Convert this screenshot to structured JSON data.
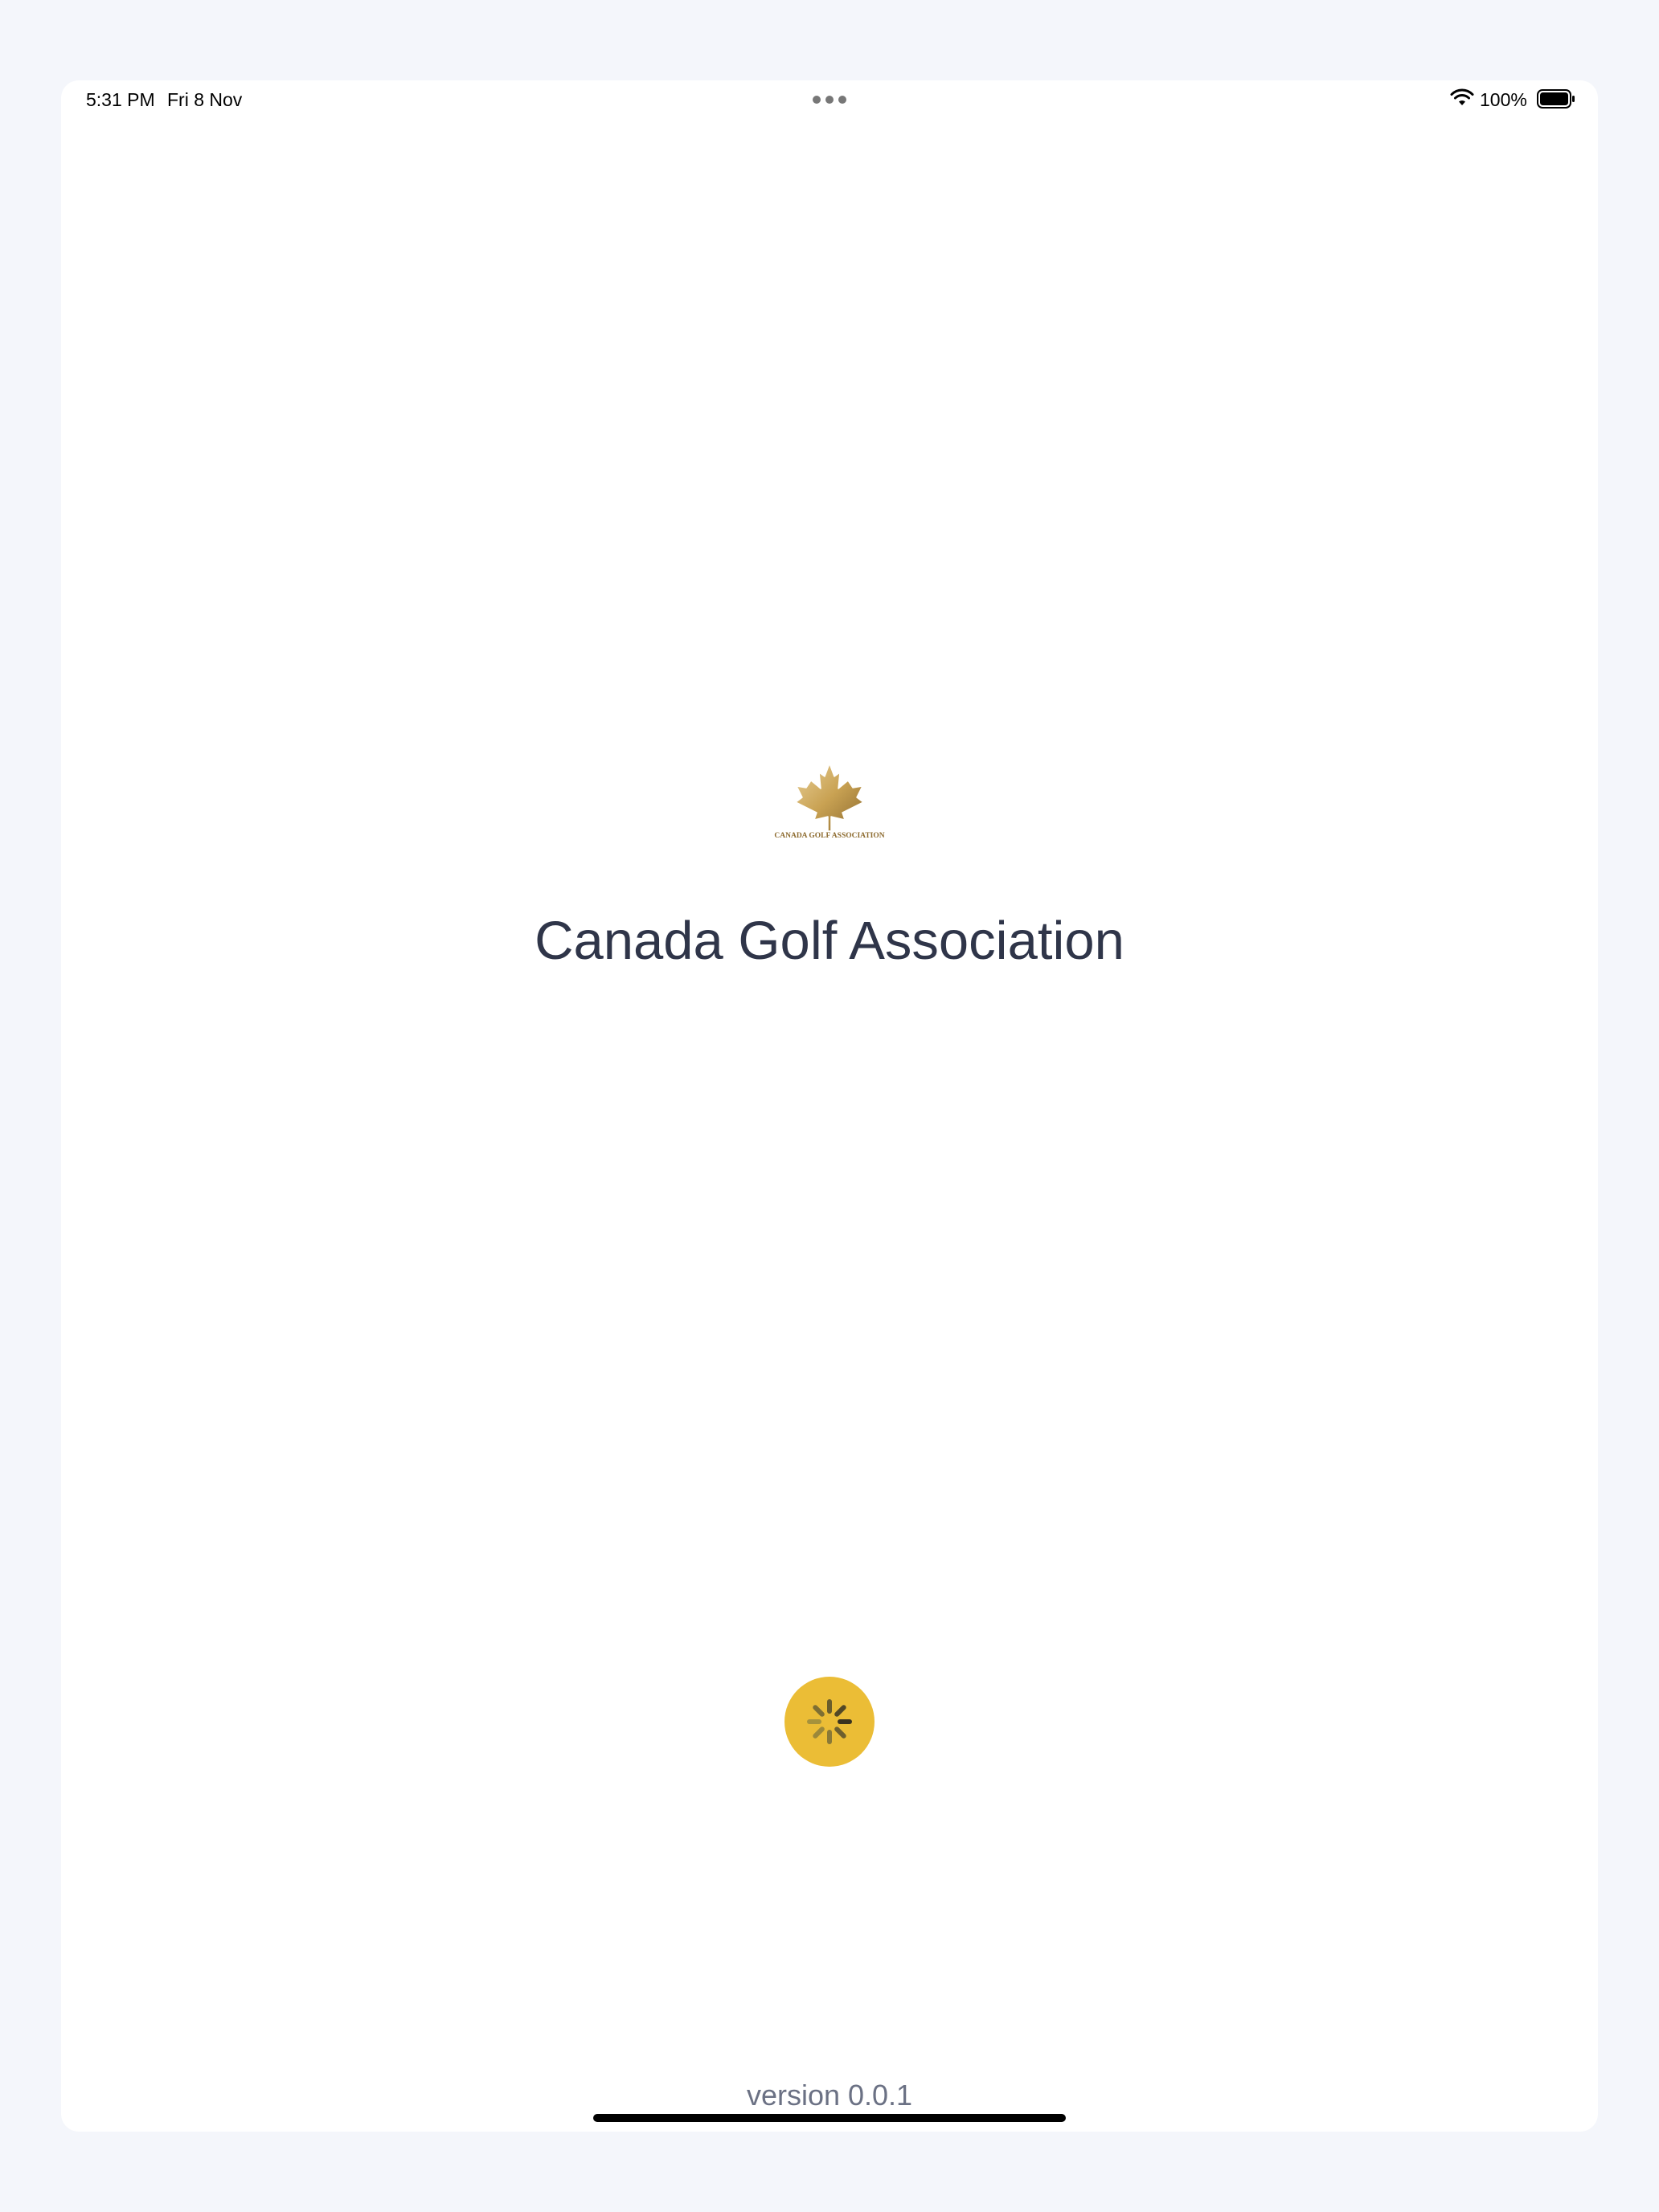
{
  "status_bar": {
    "time": "5:31 PM",
    "date": "Fri 8 Nov",
    "battery": "100%",
    "icons": [
      "wifi-icon",
      "battery-icon",
      "multitask-dots-icon"
    ]
  },
  "splash": {
    "logo_text": "CANADA GOLF ASSOCIATION",
    "title": "Canada Golf Association",
    "version": "version 0.0.1"
  },
  "loader": {
    "icon": "spinner-icon"
  },
  "colors": {
    "background": "#f4f6fb",
    "title": "#2f3549",
    "version": "#6b7184",
    "accent": "#ebbd36",
    "logo_gold": "#c9a253"
  }
}
